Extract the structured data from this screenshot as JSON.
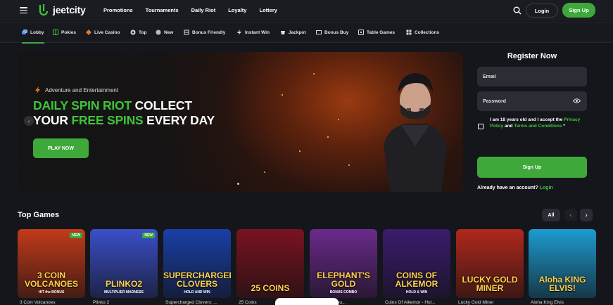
{
  "header": {
    "logo_text": "jeetcity",
    "nav": [
      "Promotions",
      "Tournaments",
      "Daily Riot",
      "Loyalty",
      "Lottery"
    ],
    "login_label": "Login",
    "signup_label": "Sign Up"
  },
  "categories": [
    {
      "label": "Lobby",
      "icon": "lobby-icon",
      "active": true
    },
    {
      "label": "Pokies",
      "icon": "pokies-icon"
    },
    {
      "label": "Live Casino",
      "icon": "live-casino-icon"
    },
    {
      "label": "Top",
      "icon": "top-icon"
    },
    {
      "label": "New",
      "icon": "new-icon"
    },
    {
      "label": "Bonus Friendly",
      "icon": "bonus-friendly-icon"
    },
    {
      "label": "Instant Win",
      "icon": "instant-win-icon"
    },
    {
      "label": "Jackpot",
      "icon": "jackpot-icon"
    },
    {
      "label": "Bonus Buy",
      "icon": "bonus-buy-icon"
    },
    {
      "label": "Table Games",
      "icon": "table-games-icon"
    },
    {
      "label": "Collections",
      "icon": "collections-icon"
    }
  ],
  "banner": {
    "tag": "Adventure and Entertainment",
    "title_line1_green": "DAILY SPIN RIOT",
    "title_line1_white": " COLLECT",
    "title_line2_white_a": "YOUR ",
    "title_line2_green": "FREE SPINS",
    "title_line2_white_b": " EVERY DAY",
    "cta": "PLAY NOW"
  },
  "register": {
    "title": "Register Now",
    "email_placeholder": "Email",
    "password_placeholder": "Password",
    "agree_text": "I am 18 years old and I accept the ",
    "privacy_link": "Privacy Policy",
    "agree_and": " and ",
    "terms_link": "Terms and Conditions",
    "agree_star": " *",
    "submit": "Sign Up",
    "already_text": "Already have an account? ",
    "login_link": "Login"
  },
  "top_games": {
    "title": "Top Games",
    "all_label": "All",
    "games": [
      {
        "name": "3 Coin Volcanoes",
        "art": "3 COIN VOLCANOES",
        "sub": "HIT the BONUS",
        "new": true,
        "bg": "#c23a1a"
      },
      {
        "name": "Plinko 2",
        "art": "PLINKO2",
        "sub": "MULTIPLIER MADNESS",
        "new": true,
        "bg": "#3b4fc9"
      },
      {
        "name": "Supercharged Clovers: ...",
        "art": "SUPERCHARGED CLOVERS",
        "sub": "HOLD AND WIN",
        "new": false,
        "bg": "#1a3fa8"
      },
      {
        "name": "25 Coins",
        "art": "25 COINS",
        "sub": "",
        "new": false,
        "bg": "#7a1320"
      },
      {
        "name": "...s Gold: Bonu...",
        "art": "ELEPHANT'S GOLD",
        "sub": "BONUS COMBO",
        "new": false,
        "bg": "#6a2a8c"
      },
      {
        "name": "Coins Of Alkemor - Hol...",
        "art": "COINS OF ALKEMOR",
        "sub": "HOLD & WIN",
        "new": false,
        "bg": "#3a1c6e"
      },
      {
        "name": "Lucky Gold Miner",
        "art": "LUCKY GOLD MINER",
        "sub": "",
        "new": false,
        "bg": "#b0281c"
      },
      {
        "name": "Aloha King Elvis",
        "art": "Aloha KING ELVIS!",
        "sub": "",
        "new": false,
        "bg": "#1e9bd0"
      }
    ]
  }
}
